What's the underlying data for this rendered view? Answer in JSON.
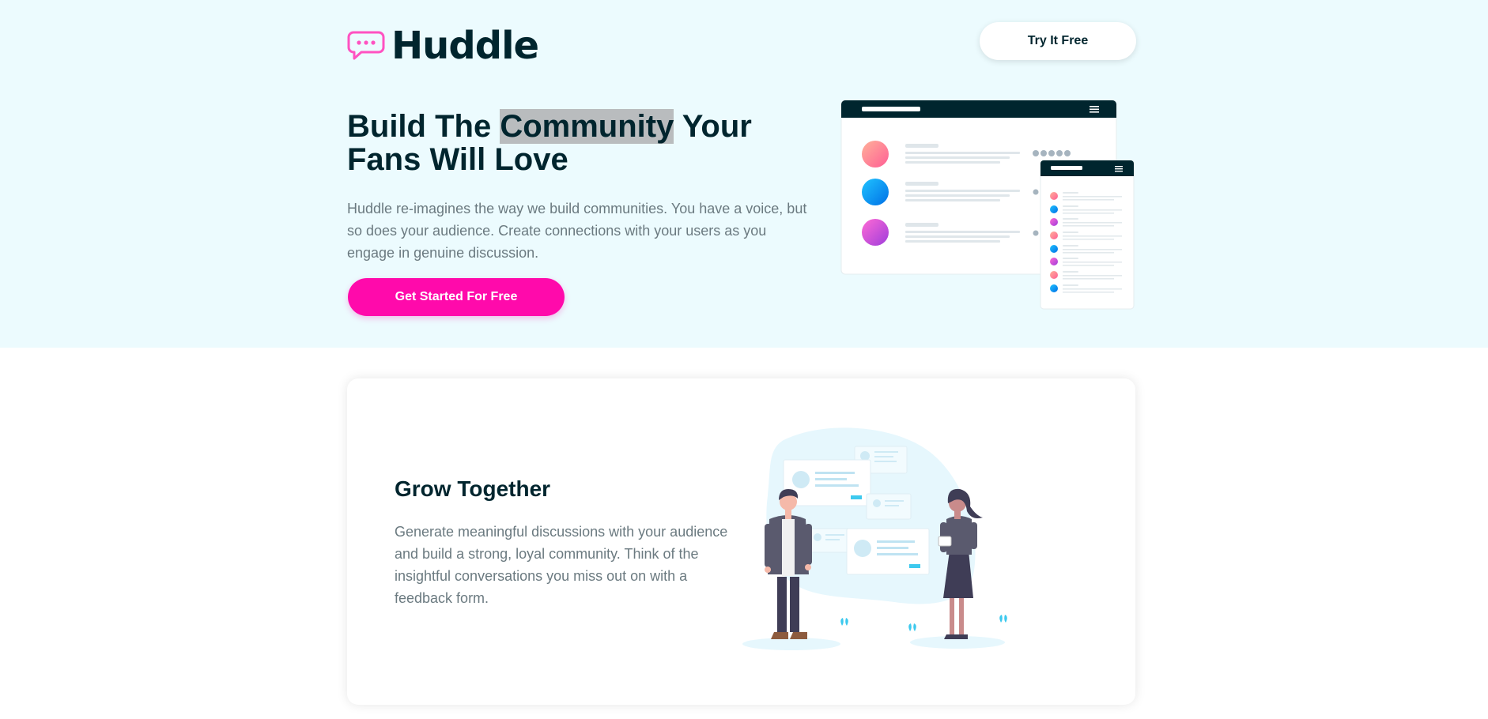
{
  "header": {
    "brand": "Huddle",
    "try_label": "Try It Free"
  },
  "hero": {
    "headline_pre": "Build The ",
    "headline_highlight": "Community",
    "headline_post": " Your Fans Will Love",
    "description": "Huddle re-imagines the way we build communities. You have a voice, but so does your audience. Create connections with your users as you engage in genuine discussion.",
    "cta_label": "Get Started For Free"
  },
  "feature": {
    "title": "Grow Together",
    "description": "Generate meaningful discussions with your audience and build a strong, loyal community. Think of the insightful conversations you miss out on with a feedback form."
  },
  "icons": {
    "logo": "chat-bubble-icon",
    "menu": "hamburger-menu-icon"
  },
  "colors": {
    "hero_bg": "#ecfbfe",
    "accent_pink": "#ff0aab",
    "dark_navy": "#00252e",
    "text_gray": "#6b7a80"
  }
}
